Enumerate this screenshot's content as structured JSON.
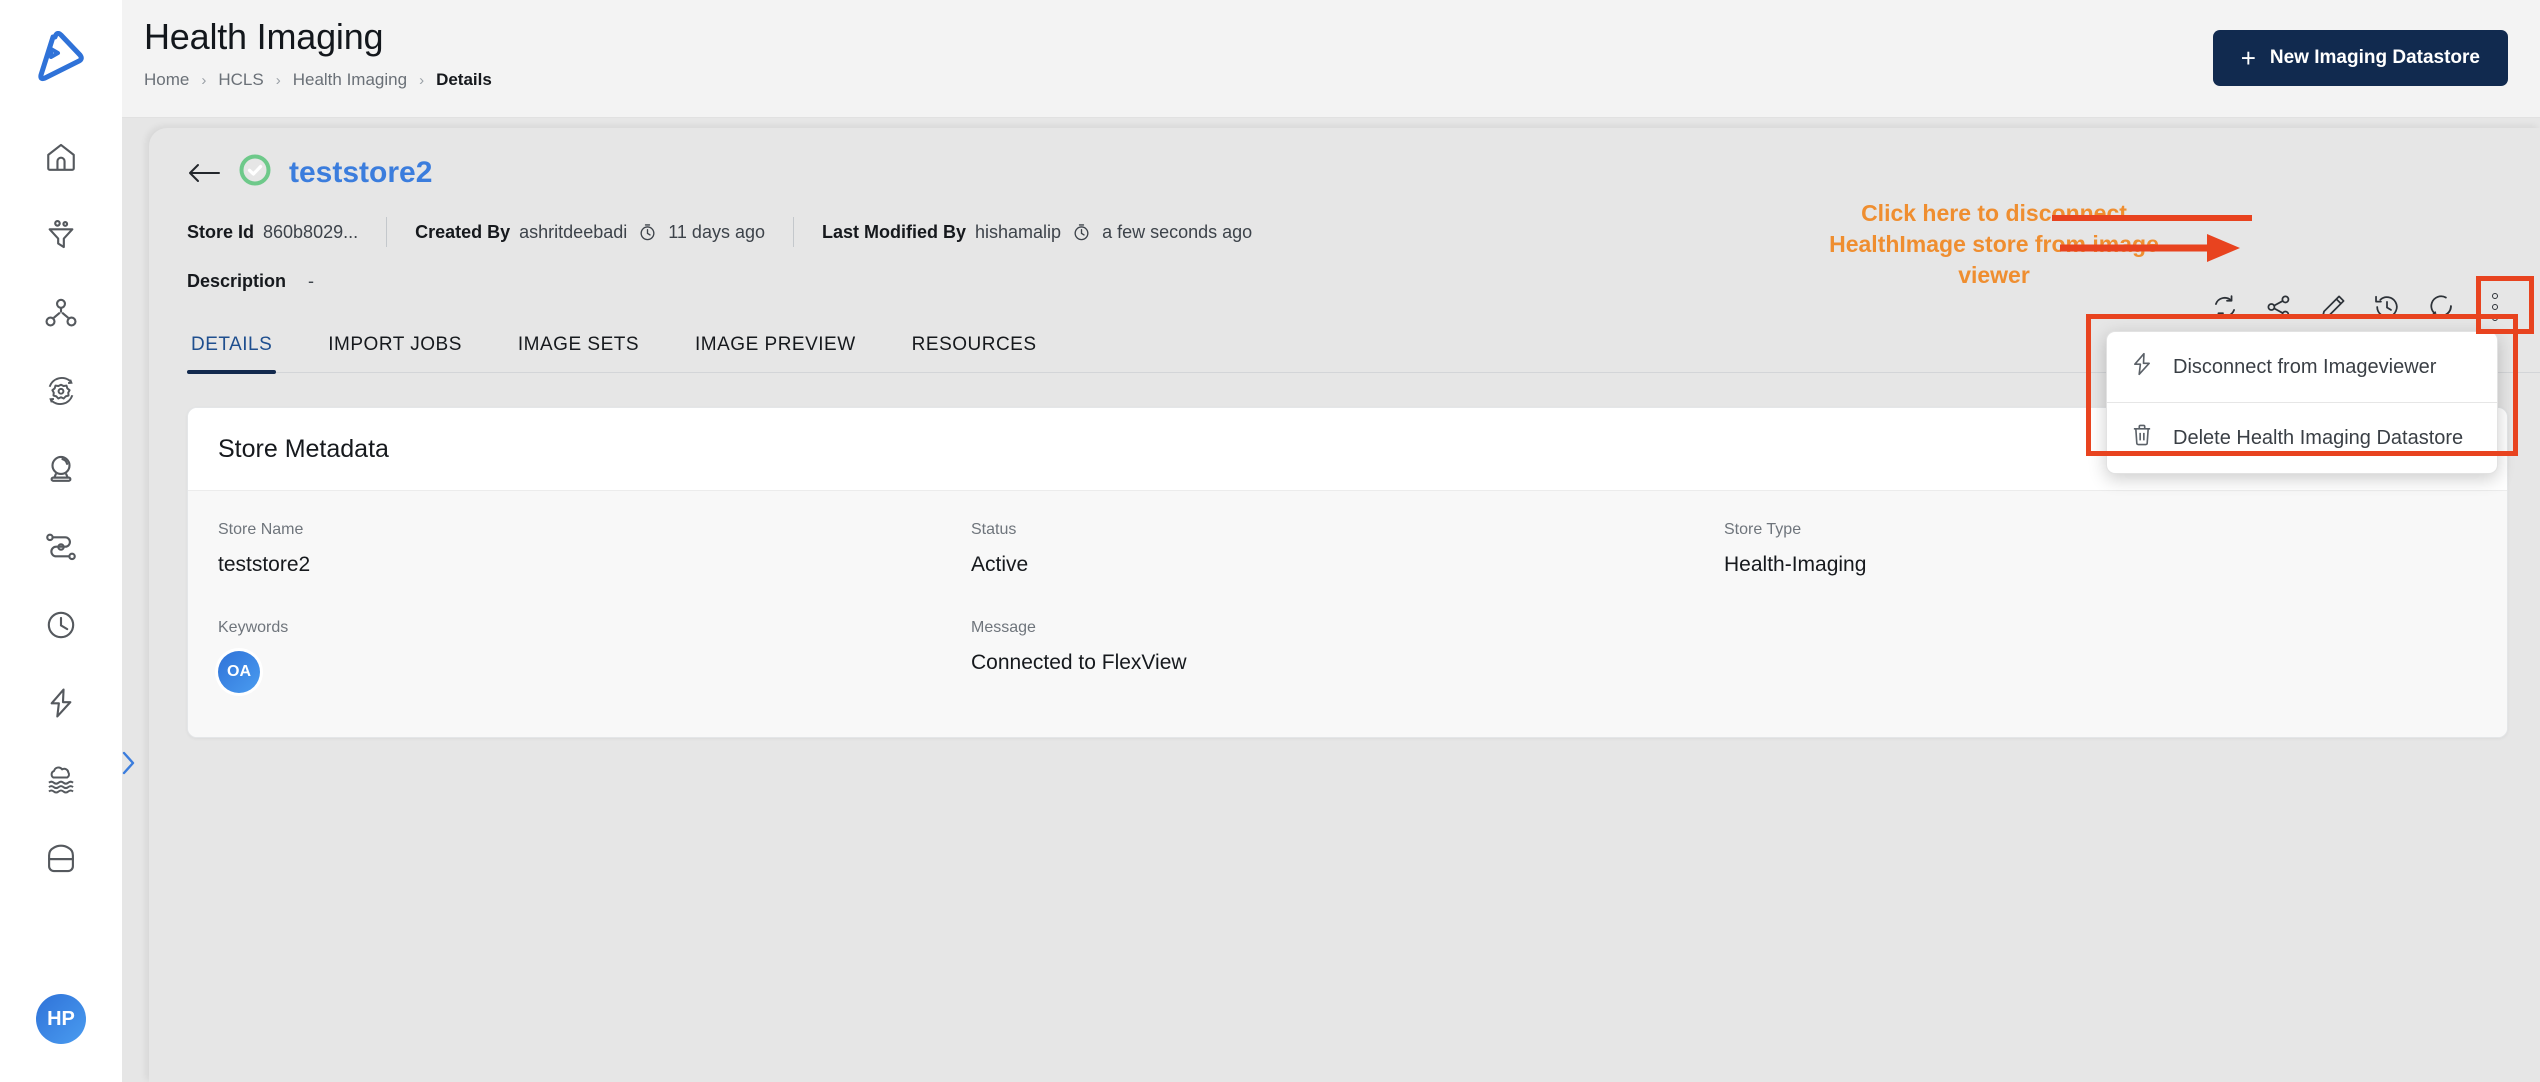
{
  "sidebar": {
    "brand_icon": "app-logo-icon",
    "items": [
      {
        "name": "home-icon"
      },
      {
        "name": "funnel-icon"
      },
      {
        "name": "network-nodes-icon"
      },
      {
        "name": "settings-sync-icon"
      },
      {
        "name": "crystal-ball-icon"
      },
      {
        "name": "workflow-path-icon"
      },
      {
        "name": "clock-icon"
      },
      {
        "name": "lightning-bolt-icon"
      },
      {
        "name": "data-lake-icon"
      },
      {
        "name": "database-icon"
      }
    ],
    "user_initials": "HP",
    "expander_icon": "chevron-right-icon"
  },
  "header": {
    "title": "Health Imaging",
    "breadcrumb": [
      "Home",
      "HCLS",
      "Health Imaging",
      "Details"
    ],
    "new_datastore_button": "New Imaging Datastore",
    "plus_glyph": "+"
  },
  "detail": {
    "back_icon": "arrow-left-icon",
    "status_icon": "check-circle-icon",
    "name": "teststore2",
    "store_id_label": "Store Id",
    "store_id_value": "860b8029...",
    "created_by_label": "Created By",
    "created_by_value": "ashritdeebadi",
    "created_at": "11 days ago",
    "last_modified_label": "Last Modified By",
    "last_modified_value": "hishamalip",
    "last_modified_at": "a few seconds ago",
    "description_label": "Description",
    "description_value": "-"
  },
  "toolbar": {
    "icons": [
      {
        "name": "refresh-icon"
      },
      {
        "name": "share-icon"
      },
      {
        "name": "edit-pencil-icon"
      },
      {
        "name": "history-icon"
      },
      {
        "name": "comment-icon"
      }
    ],
    "kebab_name": "more-options-icon"
  },
  "tabs": [
    {
      "label": "DETAILS",
      "active": true
    },
    {
      "label": "IMPORT JOBS",
      "active": false
    },
    {
      "label": "IMAGE SETS",
      "active": false
    },
    {
      "label": "IMAGE PREVIEW",
      "active": false
    },
    {
      "label": "RESOURCES",
      "active": false
    }
  ],
  "card": {
    "title": "Store Metadata",
    "collapse_icon": "chevron-up-icon",
    "fields": [
      {
        "label": "Store Name",
        "value": "teststore2"
      },
      {
        "label": "Status",
        "value": "Active"
      },
      {
        "label": "Store Type",
        "value": "Health-Imaging"
      },
      {
        "label": "Keywords",
        "value": "",
        "avatar": "OA"
      },
      {
        "label": "Message",
        "value": "Connected to FlexView"
      },
      {
        "label": "",
        "value": ""
      }
    ]
  },
  "menu": {
    "items": [
      {
        "label": "Disconnect from Imageviewer",
        "icon": "lightning-bolt-icon"
      },
      {
        "label": "Delete Health Imaging Datastore",
        "icon": "trash-icon"
      }
    ]
  },
  "annotation": {
    "text_line1": "Click here to disconnect",
    "text_line2": "HealthImage store from image viewer",
    "text_color": "#ef8e30",
    "box_color": "#e8431f"
  },
  "colors": {
    "accent_blue": "#3b7ddd",
    "navy": "#112a4f",
    "green": "#6ec98a",
    "page_bg": "#e6e6e6"
  }
}
